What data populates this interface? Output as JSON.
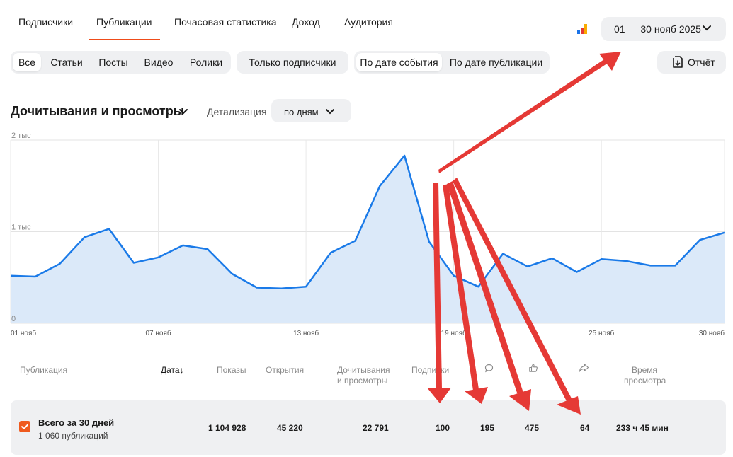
{
  "tabs": [
    {
      "label": "Подписчики",
      "active": false
    },
    {
      "label": "Публикации",
      "active": true
    },
    {
      "label": "Почасовая статистика",
      "active": false
    },
    {
      "label": "Доход",
      "active": false
    },
    {
      "label": "Аудитория",
      "active": false
    }
  ],
  "date_range": {
    "label": "01 — 30 нояб 2025"
  },
  "filters": {
    "types": [
      "Все",
      "Статьи",
      "Посты",
      "Видео",
      "Ролики"
    ],
    "subscribers_only": "Только подписчики",
    "date_modes": [
      "По дате события",
      "По дате публикации"
    ]
  },
  "report_button": "Отчёт",
  "metric": {
    "title": "Дочитывания и просмотры",
    "detail_label": "Детализация",
    "detail_value": "по дням"
  },
  "chart_data": {
    "type": "area",
    "x": [
      "01 нояб",
      "02 нояб",
      "03 нояб",
      "04 нояб",
      "05 нояб",
      "06 нояб",
      "07 нояб",
      "08 нояб",
      "09 нояб",
      "10 нояб",
      "11 нояб",
      "12 нояб",
      "13 нояб",
      "14 нояб",
      "15 нояб",
      "16 нояб",
      "17 нояб",
      "18 нояб",
      "19 нояб",
      "20 нояб",
      "21 нояб",
      "22 нояб",
      "23 нояб",
      "24 нояб",
      "25 нояб",
      "26 нояб",
      "27 нояб",
      "28 нояб",
      "29 нояб",
      "30 нояб"
    ],
    "series": [
      {
        "values": [
          520,
          510,
          650,
          940,
          1030,
          660,
          720,
          850,
          810,
          540,
          390,
          380,
          400,
          770,
          900,
          1500,
          1830,
          890,
          520,
          400,
          760,
          620,
          710,
          560,
          700,
          680,
          630,
          630,
          910,
          990
        ]
      }
    ],
    "ylim": [
      0,
      2000
    ],
    "yticks": [
      "0",
      "1 тыс",
      "2 тыс"
    ],
    "xticks": [
      "01 нояб",
      "07 нояб",
      "13 нояб",
      "19 нояб",
      "25 нояб",
      "30 нояб"
    ],
    "grid": true,
    "colors": {
      "line": "#1a7ae8",
      "fill": "#dbe9f9"
    }
  },
  "table": {
    "headers": {
      "publication": "Публикация",
      "date": "Дата",
      "sort_arrow": "↓",
      "impressions": "Показы",
      "opens": "Открытия",
      "reads_1": "Дочитывания",
      "reads_2": "и просмотры",
      "subscriptions": "Подписки",
      "time_1": "Время",
      "time_2": "просмотра"
    },
    "total": {
      "title": "Всего за 30 дней",
      "subtitle": "1 060 публикаций",
      "impressions": "1 104 928",
      "opens": "45 220",
      "reads": "22 791",
      "subscriptions": "100",
      "comments": "195",
      "likes": "475",
      "reposts": "64",
      "time": "233 ч 45 мин"
    }
  },
  "colors": {
    "accent": "#ef4c1a",
    "arrow": "#e53935",
    "chip_bg": "#eff0f2"
  }
}
